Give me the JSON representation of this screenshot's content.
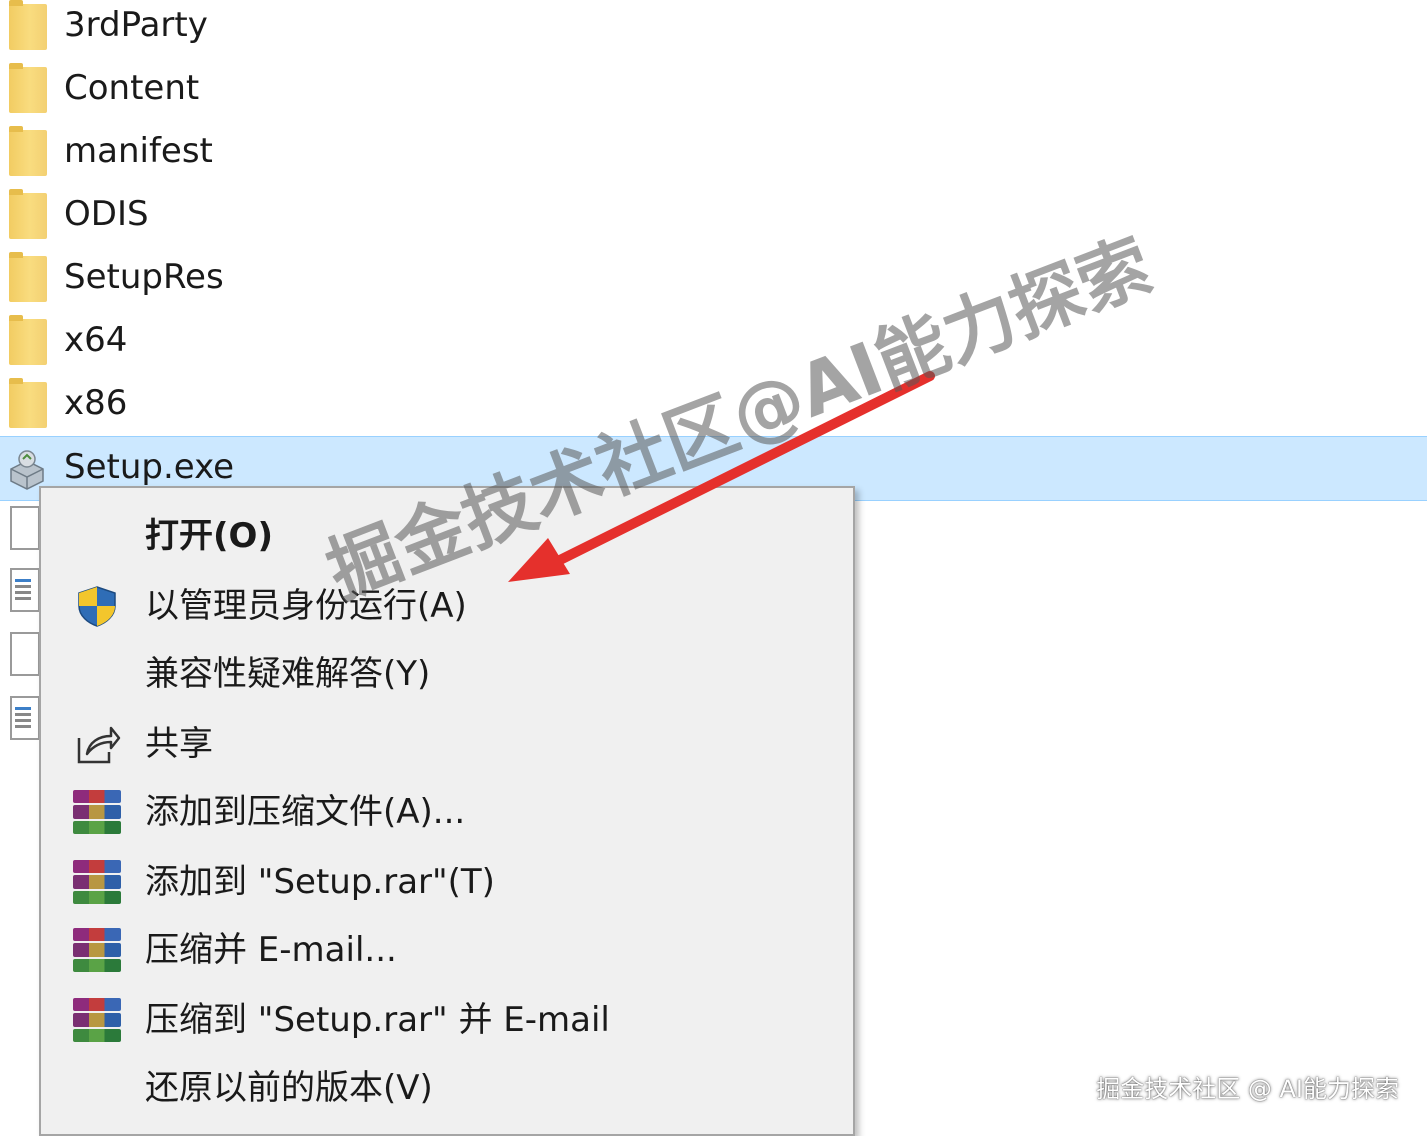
{
  "files": [
    {
      "name": "3rdParty",
      "type": "folder"
    },
    {
      "name": "Content",
      "type": "folder"
    },
    {
      "name": "manifest",
      "type": "folder"
    },
    {
      "name": "ODIS",
      "type": "folder"
    },
    {
      "name": "SetupRes",
      "type": "folder"
    },
    {
      "name": "x64",
      "type": "folder"
    },
    {
      "name": "x86",
      "type": "folder"
    },
    {
      "name": "Setup.exe",
      "type": "exe",
      "selected": true
    }
  ],
  "context_menu": {
    "items": [
      {
        "label": "打开(O)",
        "icon": "",
        "bold": true
      },
      {
        "label": "以管理员身份运行(A)",
        "icon": "uac-shield-icon"
      },
      {
        "label": "兼容性疑难解答(Y)",
        "icon": ""
      },
      {
        "label": "共享",
        "icon": "share-icon"
      },
      {
        "label": "添加到压缩文件(A)...",
        "icon": "winrar-icon"
      },
      {
        "label": "添加到 \"Setup.rar\"(T)",
        "icon": "winrar-icon"
      },
      {
        "label": "压缩并 E-mail...",
        "icon": "winrar-icon"
      },
      {
        "label": "压缩到 \"Setup.rar\" 并 E-mail",
        "icon": "winrar-icon"
      },
      {
        "label": "还原以前的版本(V)",
        "icon": ""
      }
    ]
  },
  "watermark": "掘金技术社区@AI能力探索",
  "footer_watermark": "掘金技术社区 @ AI能力探索",
  "colors": {
    "selection": "#cce8ff",
    "arrow": "#e5302c",
    "menu_bg": "#f0f0f0"
  }
}
